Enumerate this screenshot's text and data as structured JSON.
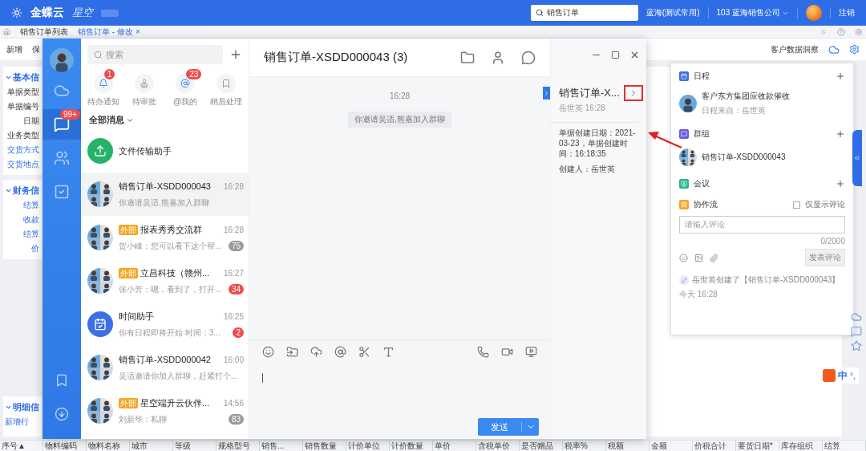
{
  "topbar": {
    "logo": "金蝶云",
    "product": "星空",
    "search": "销售订单",
    "org": "蓝海(测试常用)",
    "company": "103 蓝海销售公司",
    "logout": "注销"
  },
  "tabs": [
    {
      "label": "销售订单列表",
      "selected": false,
      "closable": false
    },
    {
      "label": "销售订单 - 修改",
      "selected": true,
      "closable": true
    }
  ],
  "close_glyph": "×",
  "toolbar": {
    "items": [
      "新增",
      "保"
    ],
    "insight": "客户数据洞察"
  },
  "form": {
    "sections": [
      {
        "title": "基本信",
        "expanded": true,
        "fields": [
          {
            "label": "单据类型",
            "link": false
          },
          {
            "label": "单据编号",
            "link": false
          },
          {
            "label": "日期",
            "link": false
          },
          {
            "label": "业务类型",
            "link": false
          },
          {
            "label": "交货方式",
            "link": true
          },
          {
            "label": "交货地点",
            "link": true
          }
        ]
      },
      {
        "title": "财务信",
        "expanded": true,
        "fields": [
          {
            "label": "结算",
            "link": true
          },
          {
            "label": "收款",
            "link": true
          },
          {
            "label": "结算",
            "link": true
          },
          {
            "label": "价",
            "link": true
          }
        ]
      }
    ],
    "detail": {
      "title": "明细信",
      "expanded": true,
      "add": "新增行"
    }
  },
  "table": {
    "columns": [
      "序号▲",
      "物料编码",
      "物料名称",
      "城市",
      "等级",
      "规格型号",
      "销售...",
      "销售数量",
      "计价单位",
      "计价数量",
      "单价",
      "含税单价",
      "是否赠品",
      "税率%",
      "税额",
      "金额",
      "价税合计",
      "要货日期*",
      "库存组织",
      "结算"
    ]
  },
  "chat": {
    "nav": [
      {
        "kind": "cloud",
        "selected": false
      },
      {
        "kind": "chat",
        "selected": true,
        "badge": "99+"
      },
      {
        "kind": "contacts",
        "selected": false
      },
      {
        "kind": "tasks",
        "selected": false
      }
    ],
    "nav_bottom": [
      {
        "kind": "bookmark"
      },
      {
        "kind": "download"
      }
    ],
    "search": {
      "placeholder": "搜索"
    },
    "quick": [
      {
        "kind": "bell",
        "label": "待办通知",
        "badge": "1"
      },
      {
        "kind": "stamp",
        "label": "待审批"
      },
      {
        "kind": "at",
        "label": "@我的",
        "badge": "23"
      },
      {
        "kind": "bookmark",
        "label": "稍后处理"
      }
    ],
    "filter": "全部消息",
    "conversations": [
      {
        "kind": "file",
        "name": "文件传输助手",
        "selected": false
      },
      {
        "kind": "group",
        "name": "销售订单-XSDD000043",
        "time": "16:28",
        "preview": "你邀请吴适,熊嘉加入群聊",
        "selected": true
      },
      {
        "kind": "group",
        "tag": "外部",
        "name": "报表秀秀交流群",
        "time": "16:28",
        "preview": "贺小峰：您可以看下这个帮...",
        "badge": {
          "text": "75",
          "muted": true
        },
        "selected": false
      },
      {
        "kind": "group",
        "tag": "外部",
        "name": "立昌科技（赣州...",
        "time": "16:27",
        "preview": "张小芳：嗯，看到了，打开...",
        "badge": {
          "text": "34",
          "muted": false
        },
        "selected": false
      },
      {
        "kind": "timer",
        "name": "时间助手",
        "time": "16:25",
        "preview": "你有日程即将开始 时间：3...",
        "badge": {
          "text": "2",
          "muted": false
        },
        "selected": false
      },
      {
        "kind": "group",
        "name": "销售订单-XSDD000042",
        "time": "16:00",
        "preview": "吴适邀请你加入群聊，赶紧打个...",
        "selected": false
      },
      {
        "kind": "group",
        "tag": "外部",
        "name": "星空端升云伙伴...",
        "time": "14:56",
        "preview": "刘新华：私聊",
        "badge": {
          "text": "83",
          "muted": true
        },
        "selected": false
      }
    ],
    "title": "销售订单-XSDD000043",
    "member_count": "(3)",
    "messages": [
      {
        "kind": "time",
        "text": "16:28"
      },
      {
        "kind": "system",
        "text": "你邀请吴适,熊嘉加入群聊"
      }
    ],
    "send": "发送",
    "info": {
      "title": "销售订单-X...",
      "author": "岳世英",
      "time": "16:28",
      "highlighted": true,
      "details": [
        "单据创建日期：2021-03-23，单据创建时间：16:18:35",
        "创建人：岳世英"
      ]
    }
  },
  "panel": {
    "sections": [
      {
        "kind": "schedule",
        "title": "日程",
        "color": "#3d6fe8",
        "items": [
          {
            "title": "客户东方集团应收款催收",
            "sub": "日程来自：岳世英"
          }
        ]
      },
      {
        "kind": "group",
        "title": "群组",
        "color": "#6a5be0",
        "items": [
          {
            "title": "销售订单-XSDD000043"
          }
        ]
      },
      {
        "kind": "meeting",
        "title": "会议",
        "color": "#26b78f"
      },
      {
        "kind": "flow",
        "title": "协作流",
        "color": "#f5a623"
      }
    ],
    "comments_only": {
      "label": "仅显示评论",
      "checked": false
    },
    "comment": {
      "placeholder": "请输入评论",
      "counter": "0/2000",
      "submit": "发表评论",
      "disabled": true
    },
    "log": {
      "text": "岳世英创建了【销售订单-XSDD000043】",
      "time": "今天 16:28"
    }
  },
  "ime": {
    "label": "中",
    "punct": "°,"
  }
}
